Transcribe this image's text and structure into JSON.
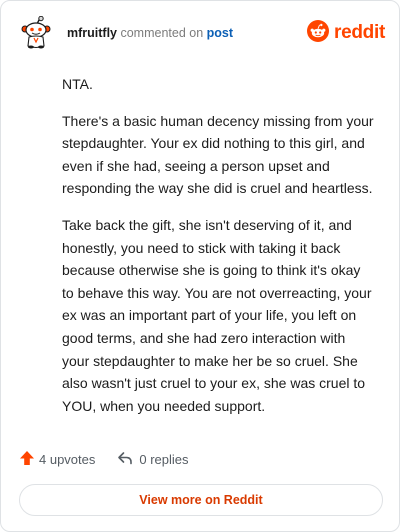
{
  "header": {
    "username": "mfruitfly",
    "action_text": "commented on",
    "post_link": "post",
    "brand_name": "reddit",
    "avatar_icon": "snoo-avatar-icon",
    "brand_icon": "reddit-logo-icon"
  },
  "comment": {
    "paragraphs": [
      "NTA.",
      "There's a basic human decency missing from your stepdaughter. Your ex did nothing to this girl, and even if she had, seeing a person upset and responding the way she did is cruel and heartless.",
      "Take back the gift, she isn't deserving of it, and honestly, you need to stick with taking it back because otherwise she is going to think it's okay to behave this way. You are not overreacting, your ex was an important part of your life, you left on good terms, and she had zero interaction with your stepdaughter to make her be so cruel. She also wasn't just cruel to your ex, she was cruel to YOU, when you needed support."
    ]
  },
  "actions": {
    "upvotes_label": "4 upvotes",
    "replies_label": "0 replies",
    "upvote_icon": "upvote-arrow-icon",
    "reply_icon": "reply-arrow-icon"
  },
  "footer": {
    "view_more_label": "View more on Reddit"
  },
  "colors": {
    "brand": "#ff4500",
    "link": "#0b5fb5",
    "cta": "#d93a00",
    "text": "#1c1c1c",
    "muted": "#555c63"
  }
}
